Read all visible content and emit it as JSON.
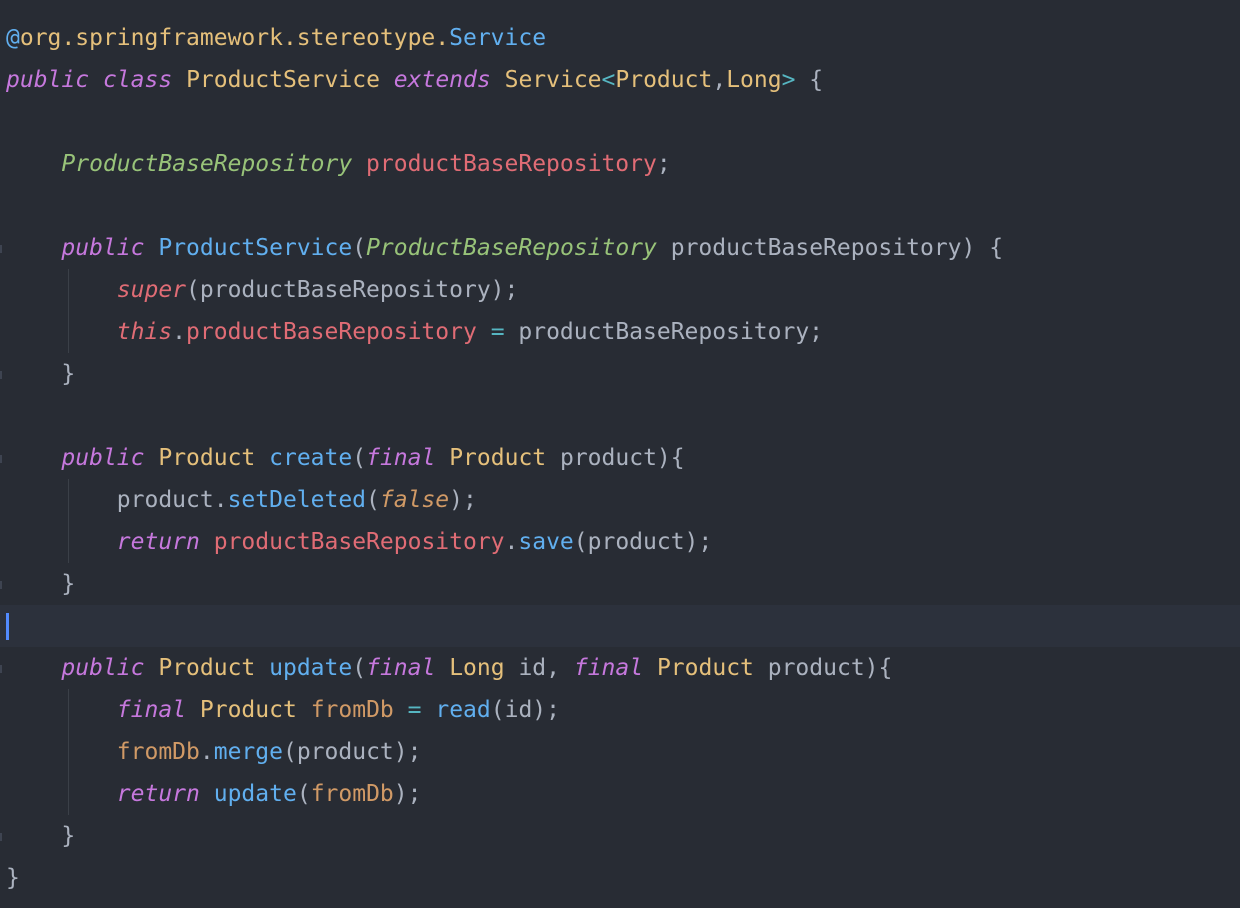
{
  "editor": {
    "theme_background": "#282c34",
    "current_line_background": "#2c313c",
    "cursor_color": "#528bff",
    "colors": {
      "keyword": "#c678dd",
      "type": "#e5c07b",
      "type_italic": "#98c379",
      "function": "#61afef",
      "field": "#e06c75",
      "variable": "#d19a66",
      "operator": "#56b6c2",
      "plain": "#abb2bf"
    },
    "lines": [
      [
        {
          "t": "@",
          "c": "fn"
        },
        {
          "t": "org.springframework.stereotype.",
          "c": "type"
        },
        {
          "t": "Service",
          "c": "fn"
        }
      ],
      [
        {
          "t": "public",
          "c": "kw"
        },
        {
          "t": " ",
          "c": "txt"
        },
        {
          "t": "class",
          "c": "kw"
        },
        {
          "t": " ",
          "c": "txt"
        },
        {
          "t": "ProductService",
          "c": "type"
        },
        {
          "t": " ",
          "c": "txt"
        },
        {
          "t": "extends",
          "c": "kw"
        },
        {
          "t": " ",
          "c": "txt"
        },
        {
          "t": "Service",
          "c": "type"
        },
        {
          "t": "<",
          "c": "op"
        },
        {
          "t": "Product",
          "c": "type"
        },
        {
          "t": ",",
          "c": "txt"
        },
        {
          "t": "Long",
          "c": "type"
        },
        {
          "t": ">",
          "c": "op"
        },
        {
          "t": " {",
          "c": "txt"
        }
      ],
      [],
      [
        {
          "t": "    ",
          "c": "txt"
        },
        {
          "t": "ProductBaseRepository",
          "c": "type-g"
        },
        {
          "t": " ",
          "c": "txt"
        },
        {
          "t": "productBaseRepository",
          "c": "field"
        },
        {
          "t": ";",
          "c": "txt"
        }
      ],
      [],
      [
        {
          "t": "    ",
          "c": "txt"
        },
        {
          "t": "public",
          "c": "kw"
        },
        {
          "t": " ",
          "c": "txt"
        },
        {
          "t": "ProductService",
          "c": "fn"
        },
        {
          "t": "(",
          "c": "txt"
        },
        {
          "t": "ProductBaseRepository",
          "c": "type-g"
        },
        {
          "t": " productBaseRepository) {",
          "c": "txt"
        }
      ],
      [
        {
          "t": "        ",
          "c": "txt"
        },
        {
          "t": "super",
          "c": "kw-red"
        },
        {
          "t": "(productBaseRepository);",
          "c": "txt"
        }
      ],
      [
        {
          "t": "        ",
          "c": "txt"
        },
        {
          "t": "this",
          "c": "kw-red"
        },
        {
          "t": ".",
          "c": "txt"
        },
        {
          "t": "productBaseRepository",
          "c": "field"
        },
        {
          "t": " ",
          "c": "txt"
        },
        {
          "t": "=",
          "c": "op"
        },
        {
          "t": " productBaseRepository;",
          "c": "txt"
        }
      ],
      [
        {
          "t": "    }",
          "c": "txt"
        }
      ],
      [],
      [
        {
          "t": "    ",
          "c": "txt"
        },
        {
          "t": "public",
          "c": "kw"
        },
        {
          "t": " ",
          "c": "txt"
        },
        {
          "t": "Product",
          "c": "type"
        },
        {
          "t": " ",
          "c": "txt"
        },
        {
          "t": "create",
          "c": "fn"
        },
        {
          "t": "(",
          "c": "txt"
        },
        {
          "t": "final",
          "c": "kw"
        },
        {
          "t": " ",
          "c": "txt"
        },
        {
          "t": "Product",
          "c": "type"
        },
        {
          "t": " product){",
          "c": "txt"
        }
      ],
      [
        {
          "t": "        product.",
          "c": "txt"
        },
        {
          "t": "setDeleted",
          "c": "fn"
        },
        {
          "t": "(",
          "c": "txt"
        },
        {
          "t": "false",
          "c": "lit"
        },
        {
          "t": ");",
          "c": "txt"
        }
      ],
      [
        {
          "t": "        ",
          "c": "txt"
        },
        {
          "t": "return",
          "c": "kw"
        },
        {
          "t": " ",
          "c": "txt"
        },
        {
          "t": "productBaseRepository",
          "c": "field"
        },
        {
          "t": ".",
          "c": "txt"
        },
        {
          "t": "save",
          "c": "fn"
        },
        {
          "t": "(product);",
          "c": "txt"
        }
      ],
      [
        {
          "t": "    }",
          "c": "txt"
        }
      ],
      [],
      [
        {
          "t": "    ",
          "c": "txt"
        },
        {
          "t": "public",
          "c": "kw"
        },
        {
          "t": " ",
          "c": "txt"
        },
        {
          "t": "Product",
          "c": "type"
        },
        {
          "t": " ",
          "c": "txt"
        },
        {
          "t": "update",
          "c": "fn"
        },
        {
          "t": "(",
          "c": "txt"
        },
        {
          "t": "final",
          "c": "kw"
        },
        {
          "t": " ",
          "c": "txt"
        },
        {
          "t": "Long",
          "c": "type"
        },
        {
          "t": " id, ",
          "c": "txt"
        },
        {
          "t": "final",
          "c": "kw"
        },
        {
          "t": " ",
          "c": "txt"
        },
        {
          "t": "Product",
          "c": "type"
        },
        {
          "t": " product){",
          "c": "txt"
        }
      ],
      [
        {
          "t": "        ",
          "c": "txt"
        },
        {
          "t": "final",
          "c": "kw"
        },
        {
          "t": " ",
          "c": "txt"
        },
        {
          "t": "Product",
          "c": "type"
        },
        {
          "t": " ",
          "c": "txt"
        },
        {
          "t": "fromDb",
          "c": "var"
        },
        {
          "t": " ",
          "c": "txt"
        },
        {
          "t": "=",
          "c": "op"
        },
        {
          "t": " ",
          "c": "txt"
        },
        {
          "t": "read",
          "c": "fn"
        },
        {
          "t": "(id);",
          "c": "txt"
        }
      ],
      [
        {
          "t": "        ",
          "c": "txt"
        },
        {
          "t": "fromDb",
          "c": "var"
        },
        {
          "t": ".",
          "c": "txt"
        },
        {
          "t": "merge",
          "c": "fn"
        },
        {
          "t": "(product);",
          "c": "txt"
        }
      ],
      [
        {
          "t": "        ",
          "c": "txt"
        },
        {
          "t": "return",
          "c": "kw"
        },
        {
          "t": " ",
          "c": "txt"
        },
        {
          "t": "update",
          "c": "fn"
        },
        {
          "t": "(",
          "c": "txt"
        },
        {
          "t": "fromDb",
          "c": "var"
        },
        {
          "t": ");",
          "c": "txt"
        }
      ],
      [
        {
          "t": "    }",
          "c": "txt"
        }
      ],
      [
        {
          "t": "}",
          "c": "txt"
        }
      ]
    ],
    "current_line": 14,
    "guide_lines": [
      6,
      7,
      11,
      12,
      16,
      17,
      18
    ],
    "fold_lines": [
      5,
      8,
      10,
      13,
      15,
      19
    ]
  }
}
